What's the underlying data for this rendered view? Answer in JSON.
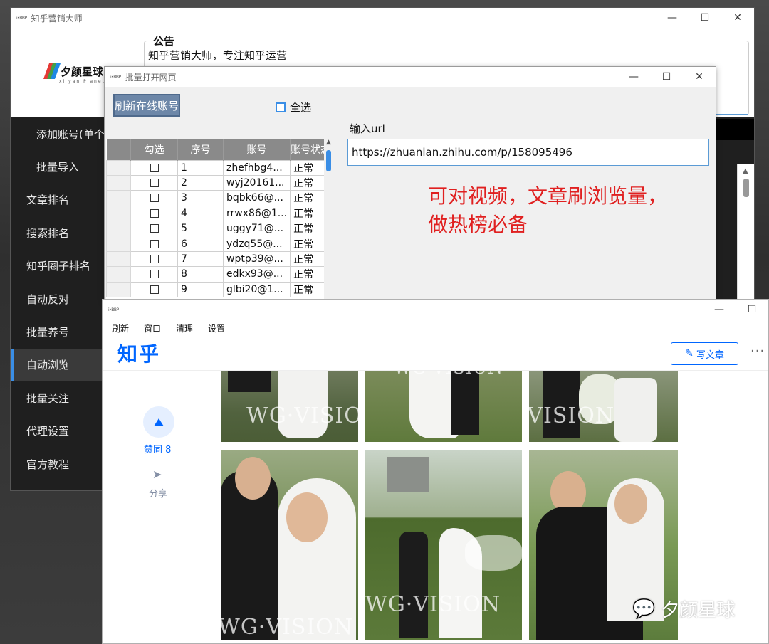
{
  "main_window": {
    "title": "知乎营销大师",
    "icon_text": "i•BBP",
    "controls": {
      "minimize": "—",
      "maximize": "☐",
      "close": "✕"
    },
    "logo": {
      "text": "夕颜星球",
      "subtext": "xi yan Planet"
    },
    "notice": {
      "legend": "公告",
      "text": "知乎营销大师，专注知乎运营"
    },
    "sidebar": [
      {
        "label": "添加账号(单个)",
        "sub": true,
        "active": false
      },
      {
        "label": "批量导入",
        "sub": true,
        "active": false
      },
      {
        "label": "文章排名",
        "sub": false,
        "active": false
      },
      {
        "label": "搜索排名",
        "sub": false,
        "active": false
      },
      {
        "label": "知乎圈子排名",
        "sub": false,
        "active": false
      },
      {
        "label": "自动反对",
        "sub": false,
        "active": false
      },
      {
        "label": "批量养号",
        "sub": false,
        "active": false
      },
      {
        "label": "自动浏览",
        "sub": false,
        "active": true
      },
      {
        "label": "批量关注",
        "sub": false,
        "active": false
      },
      {
        "label": "代理设置",
        "sub": false,
        "active": false
      },
      {
        "label": "官方教程",
        "sub": false,
        "active": false
      }
    ]
  },
  "batch_window": {
    "title": "批量打开网页",
    "icon_text": "i•BBP",
    "controls": {
      "minimize": "—",
      "maximize": "☐",
      "close": "✕"
    },
    "refresh_button": "刷新在线账号",
    "select_all": "全选",
    "table": {
      "headers": [
        "",
        "勾选",
        "序号",
        "账号",
        "账号状态"
      ],
      "rows": [
        {
          "no": "1",
          "account": "zhefhbg4...",
          "status": "正常"
        },
        {
          "no": "2",
          "account": "wyj20161...",
          "status": "正常"
        },
        {
          "no": "3",
          "account": "bqbk66@...",
          "status": "正常"
        },
        {
          "no": "4",
          "account": "rrwx86@1...",
          "status": "正常"
        },
        {
          "no": "5",
          "account": "uggy71@...",
          "status": "正常"
        },
        {
          "no": "6",
          "account": "ydzq55@...",
          "status": "正常"
        },
        {
          "no": "7",
          "account": "wptp39@...",
          "status": "正常"
        },
        {
          "no": "8",
          "account": "edkx93@...",
          "status": "正常"
        },
        {
          "no": "9",
          "account": "glbi20@1...",
          "status": "正常"
        }
      ]
    },
    "url_label": "输入url",
    "url_value": "https://zhuanlan.zhihu.com/p/158095496",
    "promo_lines": [
      "可对视频，文章刷浏览量，",
      "做热榜必备"
    ]
  },
  "zhihu_window": {
    "icon_text": "i•BBP",
    "controls": {
      "minimize": "—",
      "maximize": "☐"
    },
    "menu": [
      "刷新",
      "窗口",
      "清理",
      "设置"
    ],
    "logo": "知乎",
    "write_button": "写文章",
    "more": "···",
    "vote_label": "赞同 8",
    "share_label": "分享",
    "watermark": "WG·VISION"
  },
  "wechat_watermark": "夕颜星球",
  "colors": {
    "accent": "#3a8ee6",
    "zhihu_blue": "#0066ff",
    "promo_red": "#e02020",
    "sidebar_bg": "#1f1f1f"
  }
}
